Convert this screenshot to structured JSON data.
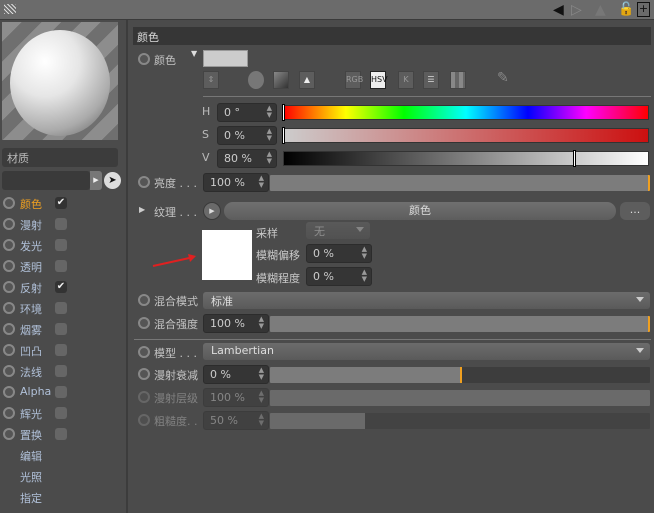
{
  "titlebar": {
    "icons": [
      "grip-icon",
      "arrow-left-icon",
      "arrow-right-icon",
      "arrow-up-icon",
      "lock-icon",
      "new-panel-icon"
    ]
  },
  "left": {
    "material_name": "材质",
    "channels": [
      {
        "label": "颜色",
        "checked": true,
        "active": true
      },
      {
        "label": "漫射",
        "checked": false
      },
      {
        "label": "发光",
        "checked": false
      },
      {
        "label": "透明",
        "checked": false
      },
      {
        "label": "反射",
        "checked": true
      },
      {
        "label": "环境",
        "checked": false
      },
      {
        "label": "烟雾",
        "checked": false
      },
      {
        "label": "凹凸",
        "checked": false
      },
      {
        "label": "法线",
        "checked": false
      },
      {
        "label": "Alpha",
        "checked": false
      },
      {
        "label": "辉光",
        "checked": false
      },
      {
        "label": "置换",
        "checked": false
      }
    ],
    "extras": [
      "编辑",
      "光照",
      "指定"
    ],
    "check_glyph": "✔"
  },
  "section": {
    "title": "颜色"
  },
  "color": {
    "label": "颜色",
    "swatch": "#cccccc",
    "modes": [
      "RGB",
      "HSV",
      "K"
    ],
    "active_mode": "HSV",
    "h": {
      "label": "H",
      "value": "0 °",
      "fraction": 0
    },
    "s": {
      "label": "S",
      "value": "0 %",
      "fraction": 0
    },
    "v": {
      "label": "V",
      "value": "80 %",
      "fraction": 0.8
    }
  },
  "brightness": {
    "label": "亮度 . . .",
    "value": "100 %",
    "fraction": 1
  },
  "texture": {
    "label": "纹理 . . .",
    "button": "颜色",
    "more": "...",
    "sampling_label": "采样",
    "sampling_value": "无",
    "blur_offset_label": "模糊偏移",
    "blur_offset_value": "0 %",
    "blur_scale_label": "模糊程度",
    "blur_scale_value": "0 %"
  },
  "mix_mode": {
    "label": "混合模式",
    "value": "标准"
  },
  "mix_strength": {
    "label": "混合强度",
    "value": "100 %",
    "fraction": 1
  },
  "model": {
    "label": "模型 . . .",
    "value": "Lambertian"
  },
  "diffuse_falloff": {
    "label": "漫射衰减",
    "value": "0 %",
    "fraction": 0.5
  },
  "diffuse_level": {
    "label": "漫射层级",
    "value": "100 %",
    "fraction": 1
  },
  "roughness": {
    "label": "粗糙度. .",
    "value": "50 %",
    "fraction": 0.25
  },
  "colors": {
    "accent": "#f0a020",
    "background": "#4b4b4b",
    "annotation_arrow": "#e02020"
  }
}
